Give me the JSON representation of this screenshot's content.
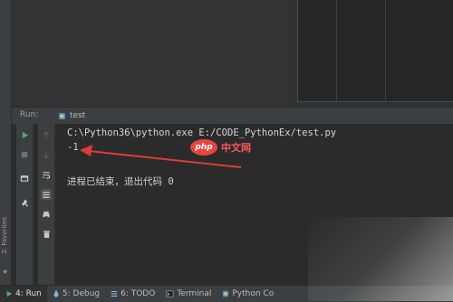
{
  "run_panel": {
    "label": "Run:",
    "tab_label": "test"
  },
  "console": {
    "command": "C:\\Python36\\python.exe E:/CODE_PythonEx/test.py",
    "output": "-1",
    "exit_message": "进程已结束，退出代码 0"
  },
  "watermark": {
    "logo_text": "php",
    "text": "中文网"
  },
  "left_strip": {
    "favorites_label": "2: Favorites"
  },
  "statusbar": {
    "items": [
      {
        "label": "4: Run",
        "icon": "play-icon"
      },
      {
        "label": "5: Debug",
        "icon": "bug-icon"
      },
      {
        "label": "6: TODO",
        "icon": "list-icon"
      },
      {
        "label": "Terminal",
        "icon": "terminal-icon"
      },
      {
        "label": "Python Co",
        "icon": "python-console-icon"
      }
    ]
  },
  "colors": {
    "run_green": "#59a869",
    "arrow_red": "#e03b3b",
    "php_red": "#e8443e"
  }
}
